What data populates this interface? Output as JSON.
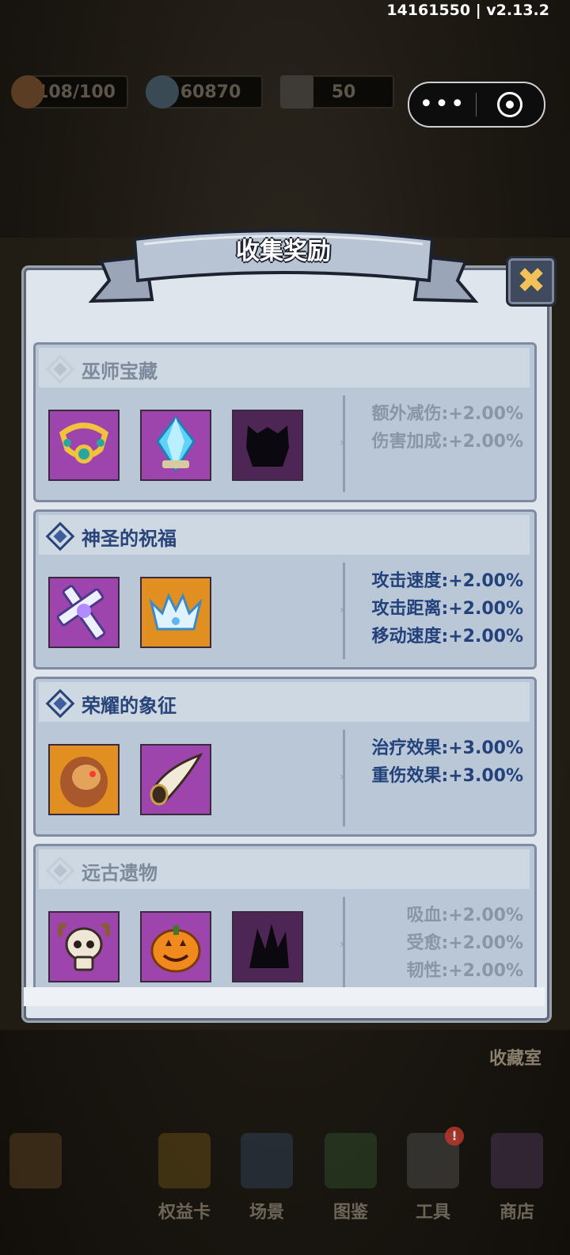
{
  "version": "14161550 | v2.13.2",
  "resources": [
    {
      "icon": "bread-icon",
      "value": "108/100"
    },
    {
      "icon": "coin-icon",
      "value": "60870"
    },
    {
      "icon": "ingot-icon",
      "value": "50"
    }
  ],
  "capsule": {
    "more": "•••",
    "close_icon": "target-icon"
  },
  "dialog": {
    "title": "收集奖励",
    "close_icon": "close-icon",
    "close_symbol": "✖",
    "sets": [
      {
        "name": "巫师宝藏",
        "active": false,
        "items": [
          {
            "icon": "necklace-icon",
            "color": "purple"
          },
          {
            "icon": "crystal-icon",
            "color": "purple"
          },
          {
            "icon": "locked-item-icon",
            "color": "locked"
          }
        ],
        "stats": [
          "额外减伤:+2.00%",
          "伤害加成:+2.00%"
        ]
      },
      {
        "name": "神圣的祝福",
        "active": true,
        "items": [
          {
            "icon": "holy-cross-icon",
            "color": "purple"
          },
          {
            "icon": "crown-icon",
            "color": "orange"
          }
        ],
        "stats": [
          "攻击速度:+2.00%",
          "攻击距离:+2.00%",
          "移动速度:+2.00%"
        ]
      },
      {
        "name": "荣耀的象征",
        "active": true,
        "items": [
          {
            "icon": "lion-pelt-icon",
            "color": "orange"
          },
          {
            "icon": "horn-icon",
            "color": "purple"
          }
        ],
        "stats": [
          "治疗效果:+3.00%",
          "重伤效果:+3.00%"
        ]
      },
      {
        "name": "远古遗物",
        "active": false,
        "items": [
          {
            "icon": "skull-icon",
            "color": "purple"
          },
          {
            "icon": "pumpkin-icon",
            "color": "purple"
          },
          {
            "icon": "locked-item-icon",
            "color": "locked"
          }
        ],
        "stats": [
          "吸血:+2.00%",
          "受愈:+2.00%",
          "韧性:+2.00%"
        ]
      }
    ]
  },
  "background": {
    "collection_room": "收藏室",
    "nav": [
      {
        "icon": "back-arrow-icon",
        "label": ""
      },
      {
        "icon": "rights-card-icon",
        "label": "权益卡"
      },
      {
        "icon": "scene-icon",
        "label": "场景"
      },
      {
        "icon": "book-icon",
        "label": "图鉴"
      },
      {
        "icon": "hammer-icon",
        "label": "工具"
      },
      {
        "icon": "shop-icon",
        "label": "商店"
      }
    ],
    "tool_badge": "!"
  }
}
